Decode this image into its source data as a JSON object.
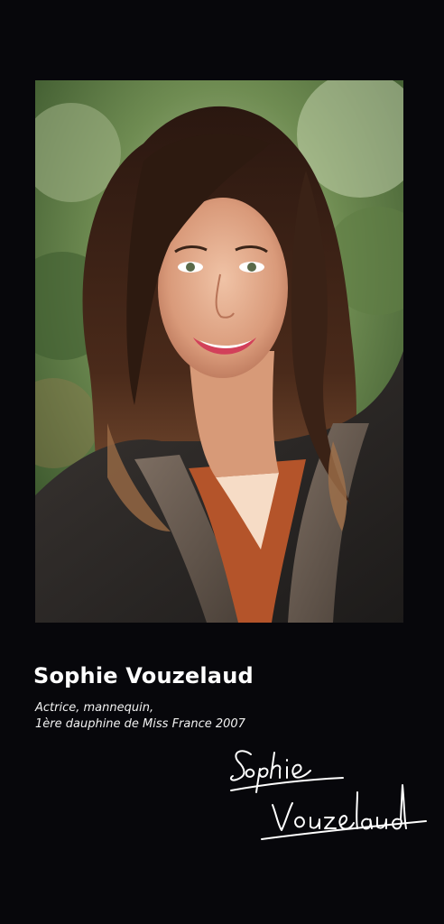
{
  "profile": {
    "name": "Sophie Vouzelaud",
    "subtitle_line1": "Actrice, mannequin,",
    "subtitle_line2": "1ère dauphine de Miss France 2007",
    "signature_text": "Sophie Vouzelaud"
  },
  "photo": {
    "icon": "portrait-photo",
    "alt": "portrait-of-woman"
  },
  "colors": {
    "background": "#07070b",
    "text": "#ffffff",
    "foliage": "#4a6b3a",
    "hair": "#3a2418",
    "jacket": "#2b2826",
    "blouse": "#b4542a"
  }
}
